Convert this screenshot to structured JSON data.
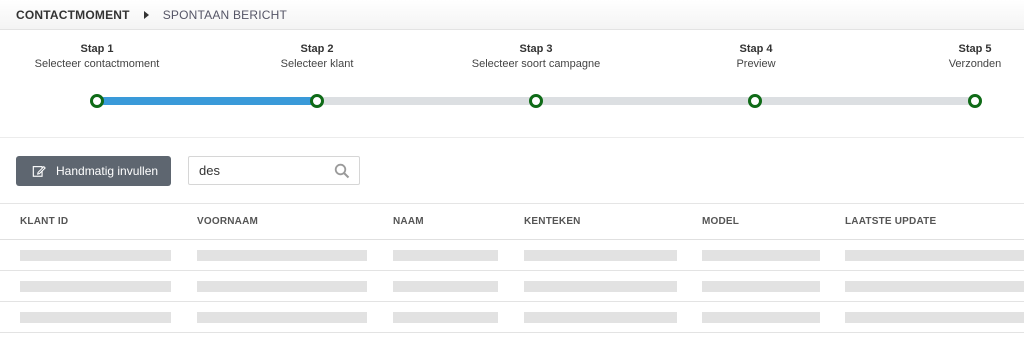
{
  "breadcrumb": {
    "root": "CONTACTMOMENT",
    "current": "SPONTAAN BERICHT"
  },
  "wizard": {
    "progress_completed_steps": 2,
    "steps": [
      {
        "title": "Stap 1",
        "label": "Selecteer contactmoment"
      },
      {
        "title": "Stap 2",
        "label": "Selecteer klant"
      },
      {
        "title": "Stap 3",
        "label": "Selecteer soort campagne"
      },
      {
        "title": "Stap 4",
        "label": "Preview"
      },
      {
        "title": "Stap 5",
        "label": "Verzonden"
      }
    ]
  },
  "toolbar": {
    "manual_button_label": "Handmatig invullen",
    "manual_button_icon": "edit-icon",
    "search_value": "des",
    "search_icon": "search-icon"
  },
  "table": {
    "columns": [
      "KLANT ID",
      "VOORNAAM",
      "NAAM",
      "KENTEKEN",
      "MODEL",
      "LAATSTE UPDATE"
    ],
    "loading_rows": 3
  },
  "colors": {
    "progress_fill": "#3a9ad9",
    "node_border": "#0f6b17",
    "button_bg": "#5e6670"
  }
}
